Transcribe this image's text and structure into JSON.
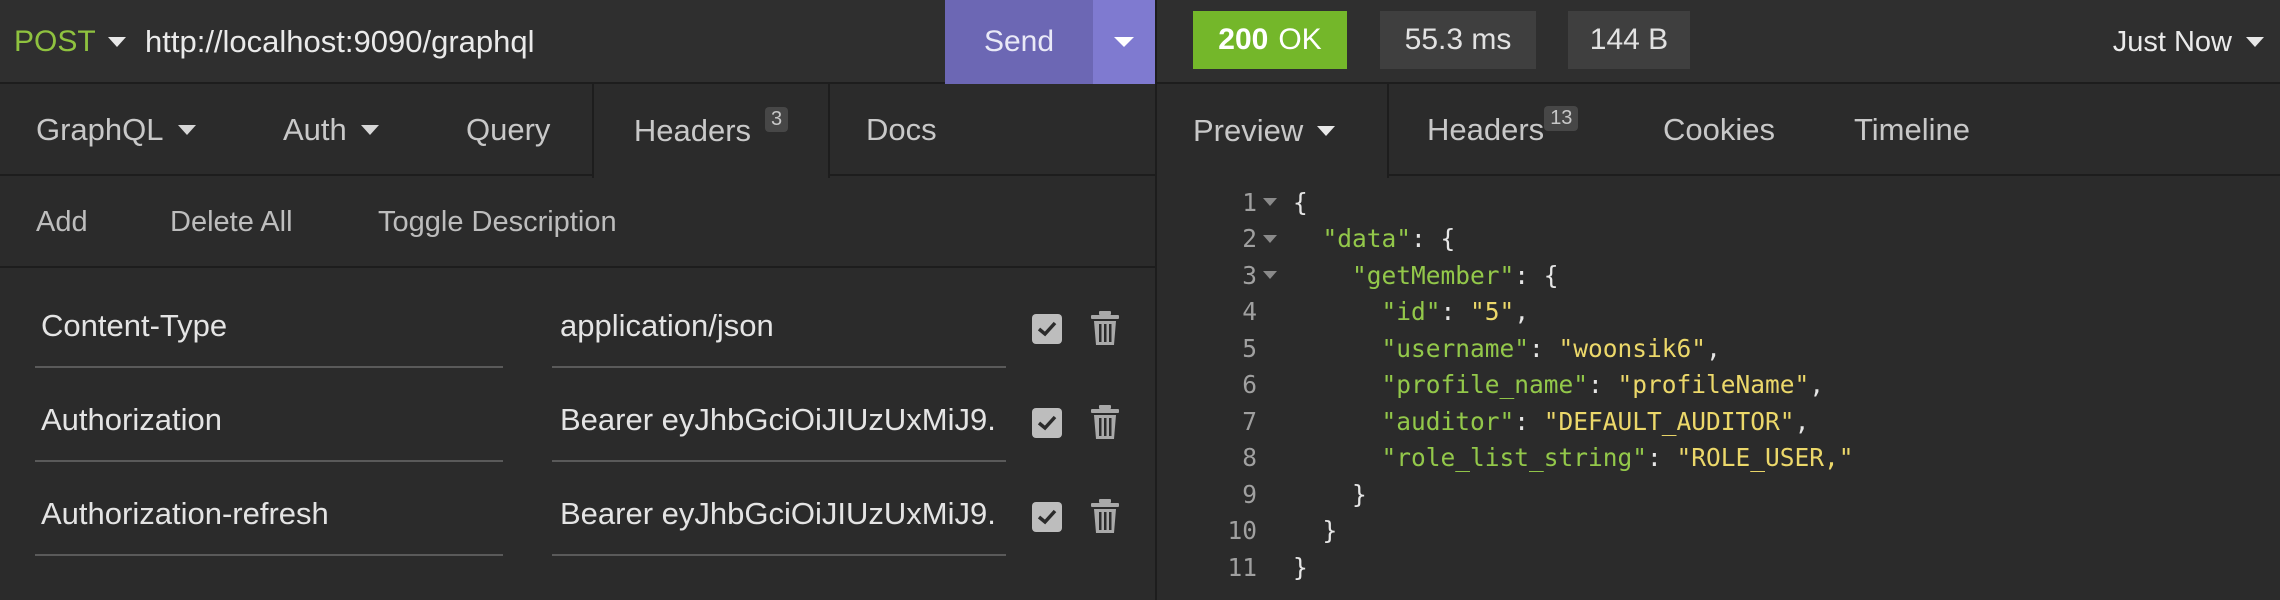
{
  "request": {
    "method": "POST",
    "url": "http://localhost:9090/graphql",
    "send_label": "Send"
  },
  "response_meta": {
    "status_code": "200",
    "status_text": "OK",
    "time": "55.3 ms",
    "size": "144 B",
    "history_label": "Just Now",
    "status_color": "#74b72a"
  },
  "request_tabs": [
    {
      "label": "GraphQL"
    },
    {
      "label": "Auth"
    },
    {
      "label": "Query"
    },
    {
      "label": "Headers",
      "badge": "3"
    },
    {
      "label": "Docs"
    }
  ],
  "header_actions": {
    "add": "Add",
    "delete_all": "Delete All",
    "toggle_description": "Toggle Description"
  },
  "headers": [
    {
      "name": "Content-Type",
      "value": "application/json",
      "enabled": true
    },
    {
      "name": "Authorization",
      "value": "Bearer eyJhbGciOiJIUzUxMiJ9.",
      "enabled": true
    },
    {
      "name": "Authorization-refresh",
      "value": "Bearer eyJhbGciOiJIUzUxMiJ9.",
      "enabled": true
    }
  ],
  "response_tabs": [
    {
      "label": "Preview"
    },
    {
      "label": "Headers",
      "badge": "13"
    },
    {
      "label": "Cookies"
    },
    {
      "label": "Timeline"
    }
  ],
  "response_body": {
    "line_numbers": [
      "1",
      "2",
      "3",
      "4",
      "5",
      "6",
      "7",
      "8",
      "9",
      "10",
      "11"
    ],
    "keys": {
      "data": "\"data\"",
      "getMember": "\"getMember\"",
      "id": "\"id\"",
      "username": "\"username\"",
      "profile_name": "\"profile_name\"",
      "auditor": "\"auditor\"",
      "role_list_string": "\"role_list_string\""
    },
    "values": {
      "id": "\"5\"",
      "username": "\"woonsik6\"",
      "profile_name": "\"profileName\"",
      "auditor": "\"DEFAULT_AUDITOR\"",
      "role_list_string": "\"ROLE_USER,\""
    }
  },
  "colors": {
    "method": "#8fc23f",
    "send": "#6c67b4",
    "json_key": "#93c84a",
    "json_string": "#ecd86a"
  }
}
